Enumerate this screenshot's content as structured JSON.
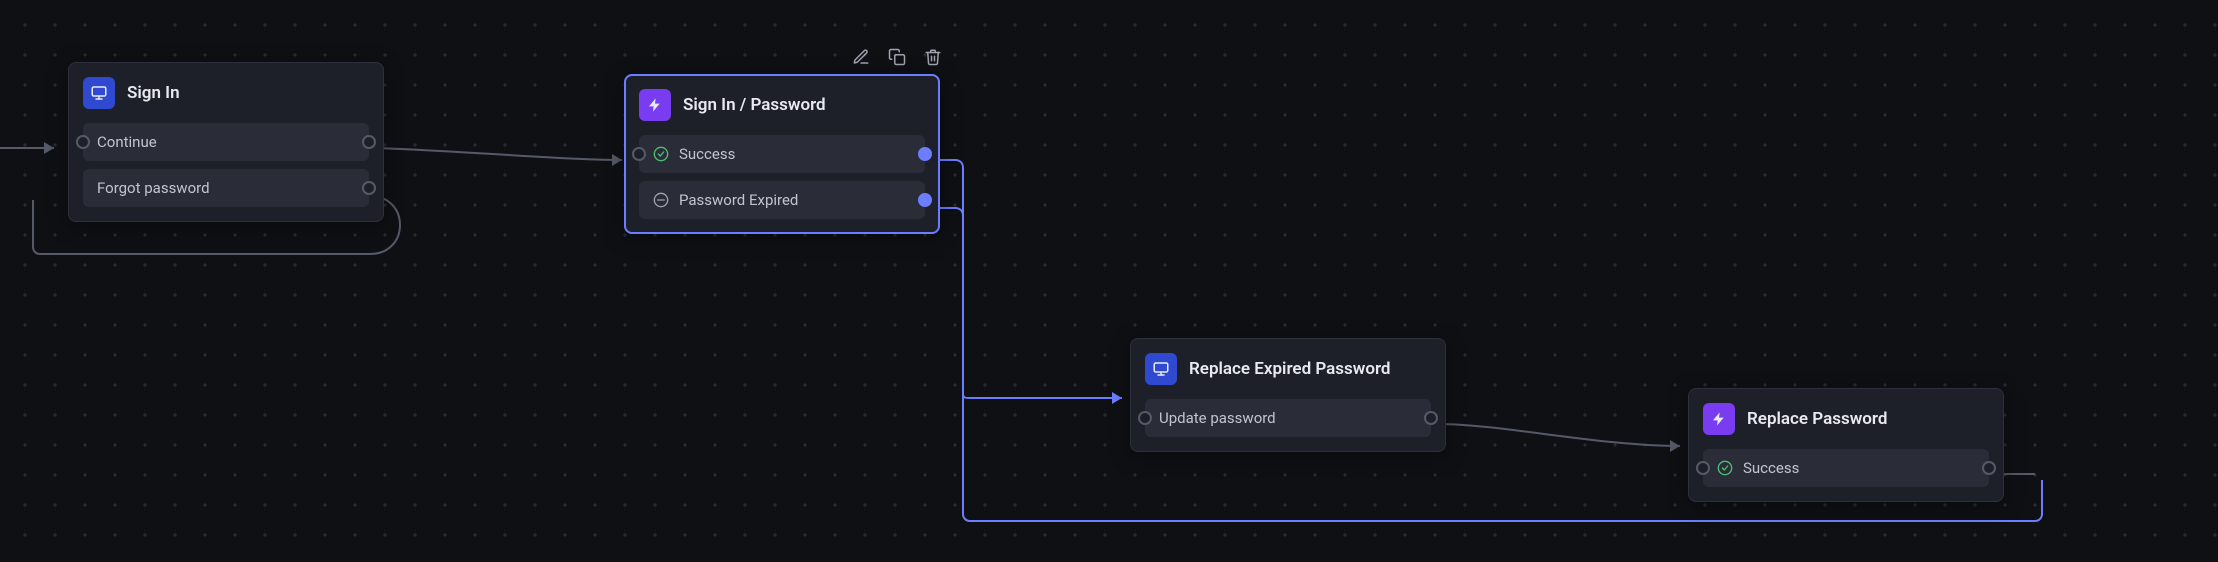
{
  "nodes": {
    "sign_in": {
      "title": "Sign In",
      "icon": "screen",
      "icon_color": "blue",
      "ports": [
        {
          "label": "Continue"
        },
        {
          "label": "Forgot password"
        }
      ]
    },
    "sign_in_password": {
      "title": "Sign In / Password",
      "icon": "lightning",
      "icon_color": "purple",
      "selected": true,
      "ports": [
        {
          "label": "Success",
          "icon": "check-circle"
        },
        {
          "label": "Password Expired",
          "icon": "no-entry"
        }
      ]
    },
    "replace_expired_password": {
      "title": "Replace Expired Password",
      "icon": "screen",
      "icon_color": "blue",
      "ports": [
        {
          "label": "Update password"
        }
      ]
    },
    "replace_password": {
      "title": "Replace Password",
      "icon": "lightning",
      "icon_color": "purple",
      "ports": [
        {
          "label": "Success",
          "icon": "check-circle"
        }
      ]
    }
  },
  "toolbar": {
    "edit": "edit-icon",
    "copy": "copy-icon",
    "delete": "trash-icon"
  },
  "colors": {
    "accent": "#6c7dff",
    "node_bg": "#1e2029",
    "port_bg": "#2a2d38",
    "canvas_bg": "#0f1014",
    "icon_blue": "#2f4ad1",
    "icon_purple": "#7a3cf0",
    "edge": "#555a68"
  }
}
